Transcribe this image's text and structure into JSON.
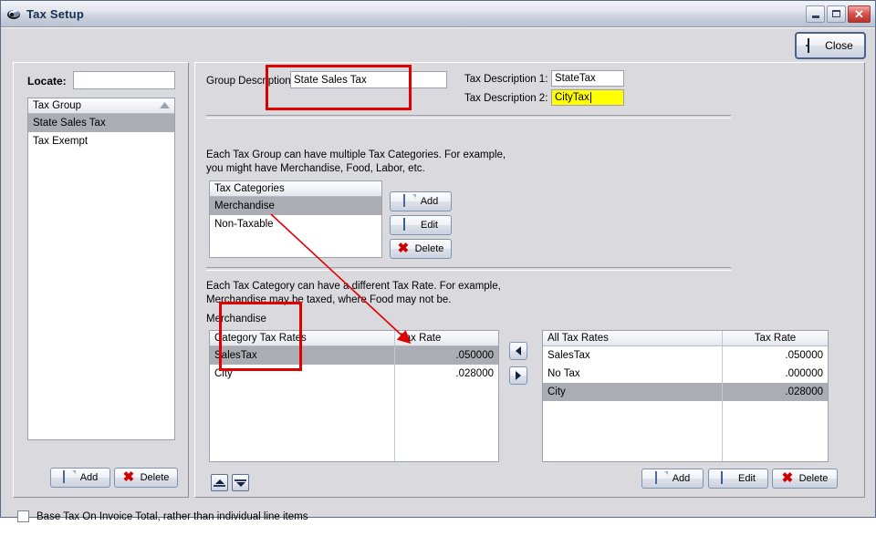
{
  "window": {
    "title": "Tax Setup",
    "icon": "app-icon",
    "minimize_label": "Minimize",
    "maximize_label": "Maximize",
    "close_label": "Close"
  },
  "toolbar": {
    "close_button": "Close",
    "close_icon": "door-exit-icon"
  },
  "left_panel": {
    "locate_label": "Locate:",
    "locate_value": "",
    "locate_placeholder": "",
    "list_header": "Tax Group",
    "sort_indicator": "ascending-triangle",
    "items": [
      {
        "label": "State Sales Tax",
        "selected": true
      },
      {
        "label": "Tax Exempt",
        "selected": false
      }
    ],
    "add_button": "Add",
    "delete_button": "Delete"
  },
  "group": {
    "description_label": "Group Description:",
    "description_value": "State Sales Tax",
    "tax_description_1_label": "Tax Description 1:",
    "tax_description_1_value": "StateTax",
    "tax_description_2_label": "Tax Description 2:",
    "tax_description_2_value": "CityTax"
  },
  "categories": {
    "help_line_1": "Each Tax Group can have multiple Tax Categories.  For example,",
    "help_line_2": "you might have Merchandise, Food, Labor, etc.",
    "list_header": "Tax Categories",
    "items": [
      {
        "label": "Merchandise",
        "selected": true
      },
      {
        "label": "Non-Taxable",
        "selected": false
      }
    ],
    "add_button": "Add",
    "edit_button": "Edit",
    "delete_button": "Delete"
  },
  "rates": {
    "help_line_1": "Each Tax Category can have a different Tax Rate.  For example,",
    "help_line_2": "Merchandise may be taxed, where Food may not be.",
    "selected_category": "Merchandise",
    "category_table": {
      "columns": [
        "Category Tax Rates",
        "",
        "Tax Rate"
      ],
      "rows": [
        {
          "name": "SalesTax",
          "rate": ".050000",
          "selected": true
        },
        {
          "name": "City",
          "rate": ".028000",
          "selected": false
        }
      ]
    },
    "move_left_button": "◄",
    "move_right_button": "►",
    "all_table": {
      "columns": [
        "All Tax Rates",
        "Tax Rate"
      ],
      "rows": [
        {
          "name": "SalesTax",
          "rate": ".050000",
          "selected": false
        },
        {
          "name": "No Tax",
          "rate": ".000000",
          "selected": false
        },
        {
          "name": "City",
          "rate": ".028000",
          "selected": true
        }
      ]
    },
    "all_add_button": "Add",
    "all_edit_button": "Edit",
    "all_delete_button": "Delete",
    "move_up_button": "move-up",
    "move_down_button": "move-down"
  },
  "footer": {
    "checkbox_label": "Base Tax On Invoice Total, rather than individual line items",
    "checkbox_checked": false
  },
  "colors": {
    "annotation": "#e00000",
    "highlight_field": "#ffff00",
    "selection": "#acacb4",
    "window_bg": "#d9d9de"
  }
}
